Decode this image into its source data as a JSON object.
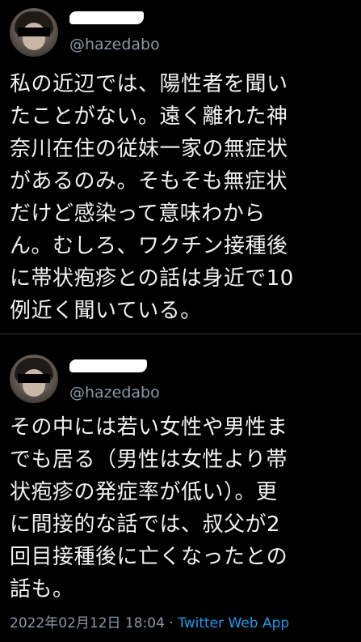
{
  "tweets": [
    {
      "handle": "@hazedabo",
      "text_lines": [
        "私の近辺では、陽性者を聞い",
        "たことがない。遠く離れた神",
        "奈川在住の従妹一家の無症状",
        "があるのみ。そもそも無症状",
        "だけど感染って意味わから",
        "ん。むしろ、ワクチン接種後",
        "に帯状疱疹との話は身近で10",
        "例近く聞いている。"
      ]
    },
    {
      "handle": "@hazedabo",
      "text_lines": [
        "その中には若い女性や男性ま",
        "でも居る（男性は女性より帯",
        "状疱疹の発症率が低い）。更",
        "に間接的な話では、叔父が2",
        "回目接種後に亡くなったとの",
        "話も。"
      ],
      "timestamp": "2022年02月12日 18:04",
      "separator": "·",
      "source": "Twitter Web App"
    }
  ],
  "colors": {
    "background": "#000000",
    "text": "#f2f2f2",
    "secondary": "#8b98a5",
    "accent": "#1d9bf0"
  }
}
